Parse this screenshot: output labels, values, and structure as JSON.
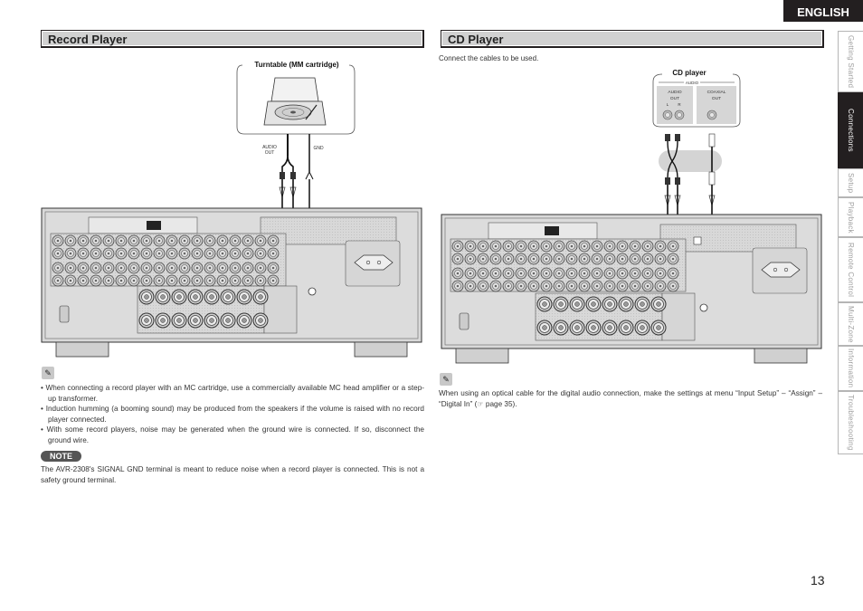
{
  "header": {
    "language_tab": "ENGLISH"
  },
  "side_tabs": [
    {
      "label": "Getting Started",
      "active": false
    },
    {
      "label": "Connections",
      "active": true
    },
    {
      "label": "Setup",
      "active": false
    },
    {
      "label": "Playback",
      "active": false
    },
    {
      "label": "Remote Control",
      "active": false
    },
    {
      "label": "Multi-Zone",
      "active": false
    },
    {
      "label": "Information",
      "active": false
    },
    {
      "label": "Troubleshooting",
      "active": false
    }
  ],
  "record_player": {
    "title": "Record Player",
    "device_label": "Turntable (MM cartridge)",
    "audio_out_label_1": "AUDIO",
    "audio_out_label_2": "OUT",
    "gnd_label": "GND",
    "bullets": [
      "When connecting a record player with an MC cartridge, use a commercially available MC head amplifier or a step-up transformer.",
      "Induction humming (a booming sound) may be produced from the speakers if the volume is raised with no record player connected.",
      "With some record players, noise may be generated when the ground wire is connected. If so, disconnect the ground wire."
    ],
    "note_label": "NOTE",
    "note_text": "The AVR-2308's SIGNAL GND terminal is meant to reduce noise when a record player is connected. This is not a safety ground terminal."
  },
  "cd_player": {
    "title": "CD Player",
    "intro": "Connect the cables to be used.",
    "device_label": "CD player",
    "audio_group": "AUDIO",
    "audio_out_1": "AUDIO",
    "audio_out_2": "OUT",
    "left": "L",
    "right": "R",
    "coaxial_1": "COAXIAL",
    "coaxial_2": "OUT",
    "memo_text": "When using an optical cable for the digital audio connection, make the settings at menu “Input Setup” – “Assign” – “Digital In” (☞ page 35)."
  },
  "footer": {
    "page_number": "13"
  }
}
